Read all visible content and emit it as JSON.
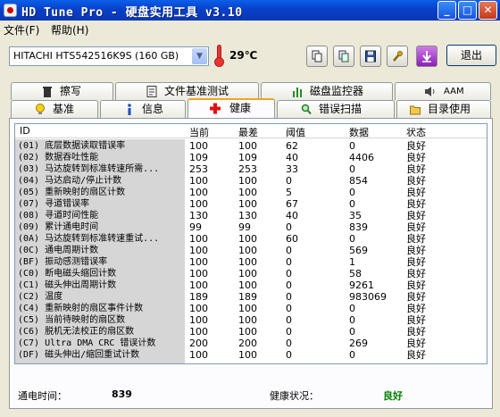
{
  "window": {
    "title": "HD Tune Pro - 硬盘实用工具 v3.10"
  },
  "menu": [
    {
      "label": "文件(F)"
    },
    {
      "label": "帮助(H)"
    }
  ],
  "toolbar": {
    "drive": "HITACHI HTS542516K9S (160 GB)",
    "temperature": "29℃",
    "exit_label": "退出"
  },
  "tabs": {
    "top": [
      {
        "label": "擦写",
        "icon": "trash-icon"
      },
      {
        "label": "文件基准测试",
        "icon": "file-benchmark-icon"
      },
      {
        "label": "磁盘监控器",
        "icon": "bar-chart-icon"
      },
      {
        "label": "AAM",
        "icon": "speaker-icon"
      }
    ],
    "bottom": [
      {
        "label": "基准",
        "icon": "lightbulb-icon"
      },
      {
        "label": "信息",
        "icon": "info-icon"
      },
      {
        "label": "健康",
        "icon": "red-cross-icon",
        "active": true
      },
      {
        "label": "错误扫描",
        "icon": "magnifier-icon"
      },
      {
        "label": "目录使用",
        "icon": "folder-icon"
      }
    ]
  },
  "health": {
    "columns": {
      "id": "ID",
      "current": "当前",
      "worst": "最差",
      "threshold": "阈值",
      "data": "数据",
      "status": "状态"
    },
    "rows": [
      {
        "id": "(01) 底层数据读取错误率",
        "current": "100",
        "worst": "100",
        "threshold": "62",
        "data": "0",
        "status": "良好"
      },
      {
        "id": "(02) 数据吞吐性能",
        "current": "109",
        "worst": "109",
        "threshold": "40",
        "data": "4406",
        "status": "良好"
      },
      {
        "id": "(03) 马达旋转到标准转速所需...",
        "current": "253",
        "worst": "253",
        "threshold": "33",
        "data": "0",
        "status": "良好"
      },
      {
        "id": "(04) 马达启动/停止计数",
        "current": "100",
        "worst": "100",
        "threshold": "0",
        "data": "854",
        "status": "良好"
      },
      {
        "id": "(05) 重新映射的扇区计数",
        "current": "100",
        "worst": "100",
        "threshold": "5",
        "data": "0",
        "status": "良好"
      },
      {
        "id": "(07) 寻道错误率",
        "current": "100",
        "worst": "100",
        "threshold": "67",
        "data": "0",
        "status": "良好"
      },
      {
        "id": "(08) 寻道时间性能",
        "current": "130",
        "worst": "130",
        "threshold": "40",
        "data": "35",
        "status": "良好"
      },
      {
        "id": "(09) 累计通电时间",
        "current": "99",
        "worst": "99",
        "threshold": "0",
        "data": "839",
        "status": "良好"
      },
      {
        "id": "(0A) 马达旋转到标准转速重试...",
        "current": "100",
        "worst": "100",
        "threshold": "60",
        "data": "0",
        "status": "良好"
      },
      {
        "id": "(0C) 通电周期计数",
        "current": "100",
        "worst": "100",
        "threshold": "0",
        "data": "569",
        "status": "良好"
      },
      {
        "id": "(BF) 振动感测错误率",
        "current": "100",
        "worst": "100",
        "threshold": "0",
        "data": "1",
        "status": "良好"
      },
      {
        "id": "(C0) 断电磁头缩回计数",
        "current": "100",
        "worst": "100",
        "threshold": "0",
        "data": "58",
        "status": "良好"
      },
      {
        "id": "(C1) 磁头伸出周期计数",
        "current": "100",
        "worst": "100",
        "threshold": "0",
        "data": "9261",
        "status": "良好"
      },
      {
        "id": "(C2) 温度",
        "current": "189",
        "worst": "189",
        "threshold": "0",
        "data": "983069",
        "status": "良好"
      },
      {
        "id": "(C4) 重新映射的扇区事件计数",
        "current": "100",
        "worst": "100",
        "threshold": "0",
        "data": "0",
        "status": "良好"
      },
      {
        "id": "(C5) 当前待映射的扇区数",
        "current": "100",
        "worst": "100",
        "threshold": "0",
        "data": "0",
        "status": "良好"
      },
      {
        "id": "(C6) 脱机无法校正的扇区数",
        "current": "100",
        "worst": "100",
        "threshold": "0",
        "data": "0",
        "status": "良好"
      },
      {
        "id": "(C7) Ultra DMA CRC 错误计数",
        "current": "200",
        "worst": "200",
        "threshold": "0",
        "data": "269",
        "status": "良好"
      },
      {
        "id": "(DF) 磁头伸出/缩回重试计数",
        "current": "100",
        "worst": "100",
        "threshold": "0",
        "data": "0",
        "status": "良好"
      }
    ],
    "power_on_label": "通电时间：",
    "power_on_value": "839",
    "health_label": "健康状况：",
    "health_value": "良好",
    "health_color": "#008000"
  }
}
